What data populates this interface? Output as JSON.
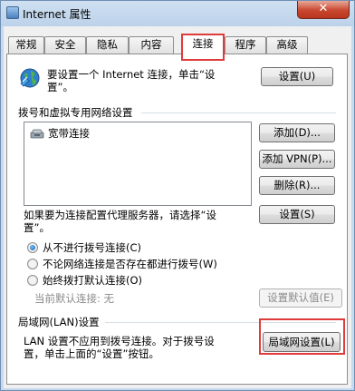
{
  "window": {
    "title": "Internet 属性",
    "close_label": "✕"
  },
  "tabs": [
    {
      "label": "常规",
      "active": false
    },
    {
      "label": "安全",
      "active": false
    },
    {
      "label": "隐私",
      "active": false
    },
    {
      "label": "内容",
      "active": false
    },
    {
      "label": "连接",
      "active": true
    },
    {
      "label": "程序",
      "active": false
    },
    {
      "label": "高级",
      "active": false
    }
  ],
  "setup": {
    "text_line1": "要设置一个 Internet 连接，单击“设",
    "text_line2": "置”。",
    "button": "设置(U)"
  },
  "dialup": {
    "heading": "拨号和虚拟专用网络设置",
    "items": [
      "宽带连接"
    ],
    "add_button": "添加(D)...",
    "add_vpn_button": "添加 VPN(P)...",
    "remove_button": "删除(R)...",
    "proxy_line1": "如果要为连接配置代理服务器，请选择“设",
    "proxy_line2": "置”。",
    "settings_button": "设置(S)",
    "options": [
      {
        "label": "从不进行拨号连接(C)",
        "checked": true
      },
      {
        "label": "不论网络连接是否存在都进行拨号(W)",
        "checked": false
      },
      {
        "label": "始终拨打默认连接(O)",
        "checked": false
      }
    ],
    "current_default_label": "当前默认连接:",
    "current_default_value": "无",
    "set_default_button": "设置默认值(E)"
  },
  "lan": {
    "heading": "局域网(LAN)设置",
    "text_line1": "LAN 设置不应用到拨号连接。对于拨号设",
    "text_line2": "置，单击上面的“设置”按钮。",
    "button": "局域网设置(L)"
  },
  "colors": {
    "highlight": "#e03b3b",
    "accent": "#1a5aa8"
  }
}
